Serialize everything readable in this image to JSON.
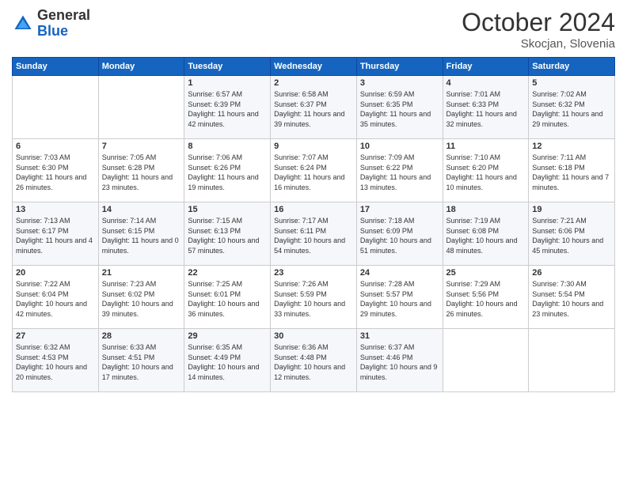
{
  "header": {
    "logo": {
      "general": "General",
      "blue": "Blue"
    },
    "month": "October 2024",
    "location": "Skocjan, Slovenia"
  },
  "weekdays": [
    "Sunday",
    "Monday",
    "Tuesday",
    "Wednesday",
    "Thursday",
    "Friday",
    "Saturday"
  ],
  "weeks": [
    [
      {
        "day": "",
        "sunrise": "",
        "sunset": "",
        "daylight": ""
      },
      {
        "day": "",
        "sunrise": "",
        "sunset": "",
        "daylight": ""
      },
      {
        "day": "1",
        "sunrise": "Sunrise: 6:57 AM",
        "sunset": "Sunset: 6:39 PM",
        "daylight": "Daylight: 11 hours and 42 minutes."
      },
      {
        "day": "2",
        "sunrise": "Sunrise: 6:58 AM",
        "sunset": "Sunset: 6:37 PM",
        "daylight": "Daylight: 11 hours and 39 minutes."
      },
      {
        "day": "3",
        "sunrise": "Sunrise: 6:59 AM",
        "sunset": "Sunset: 6:35 PM",
        "daylight": "Daylight: 11 hours and 35 minutes."
      },
      {
        "day": "4",
        "sunrise": "Sunrise: 7:01 AM",
        "sunset": "Sunset: 6:33 PM",
        "daylight": "Daylight: 11 hours and 32 minutes."
      },
      {
        "day": "5",
        "sunrise": "Sunrise: 7:02 AM",
        "sunset": "Sunset: 6:32 PM",
        "daylight": "Daylight: 11 hours and 29 minutes."
      }
    ],
    [
      {
        "day": "6",
        "sunrise": "Sunrise: 7:03 AM",
        "sunset": "Sunset: 6:30 PM",
        "daylight": "Daylight: 11 hours and 26 minutes."
      },
      {
        "day": "7",
        "sunrise": "Sunrise: 7:05 AM",
        "sunset": "Sunset: 6:28 PM",
        "daylight": "Daylight: 11 hours and 23 minutes."
      },
      {
        "day": "8",
        "sunrise": "Sunrise: 7:06 AM",
        "sunset": "Sunset: 6:26 PM",
        "daylight": "Daylight: 11 hours and 19 minutes."
      },
      {
        "day": "9",
        "sunrise": "Sunrise: 7:07 AM",
        "sunset": "Sunset: 6:24 PM",
        "daylight": "Daylight: 11 hours and 16 minutes."
      },
      {
        "day": "10",
        "sunrise": "Sunrise: 7:09 AM",
        "sunset": "Sunset: 6:22 PM",
        "daylight": "Daylight: 11 hours and 13 minutes."
      },
      {
        "day": "11",
        "sunrise": "Sunrise: 7:10 AM",
        "sunset": "Sunset: 6:20 PM",
        "daylight": "Daylight: 11 hours and 10 minutes."
      },
      {
        "day": "12",
        "sunrise": "Sunrise: 7:11 AM",
        "sunset": "Sunset: 6:18 PM",
        "daylight": "Daylight: 11 hours and 7 minutes."
      }
    ],
    [
      {
        "day": "13",
        "sunrise": "Sunrise: 7:13 AM",
        "sunset": "Sunset: 6:17 PM",
        "daylight": "Daylight: 11 hours and 4 minutes."
      },
      {
        "day": "14",
        "sunrise": "Sunrise: 7:14 AM",
        "sunset": "Sunset: 6:15 PM",
        "daylight": "Daylight: 11 hours and 0 minutes."
      },
      {
        "day": "15",
        "sunrise": "Sunrise: 7:15 AM",
        "sunset": "Sunset: 6:13 PM",
        "daylight": "Daylight: 10 hours and 57 minutes."
      },
      {
        "day": "16",
        "sunrise": "Sunrise: 7:17 AM",
        "sunset": "Sunset: 6:11 PM",
        "daylight": "Daylight: 10 hours and 54 minutes."
      },
      {
        "day": "17",
        "sunrise": "Sunrise: 7:18 AM",
        "sunset": "Sunset: 6:09 PM",
        "daylight": "Daylight: 10 hours and 51 minutes."
      },
      {
        "day": "18",
        "sunrise": "Sunrise: 7:19 AM",
        "sunset": "Sunset: 6:08 PM",
        "daylight": "Daylight: 10 hours and 48 minutes."
      },
      {
        "day": "19",
        "sunrise": "Sunrise: 7:21 AM",
        "sunset": "Sunset: 6:06 PM",
        "daylight": "Daylight: 10 hours and 45 minutes."
      }
    ],
    [
      {
        "day": "20",
        "sunrise": "Sunrise: 7:22 AM",
        "sunset": "Sunset: 6:04 PM",
        "daylight": "Daylight: 10 hours and 42 minutes."
      },
      {
        "day": "21",
        "sunrise": "Sunrise: 7:23 AM",
        "sunset": "Sunset: 6:02 PM",
        "daylight": "Daylight: 10 hours and 39 minutes."
      },
      {
        "day": "22",
        "sunrise": "Sunrise: 7:25 AM",
        "sunset": "Sunset: 6:01 PM",
        "daylight": "Daylight: 10 hours and 36 minutes."
      },
      {
        "day": "23",
        "sunrise": "Sunrise: 7:26 AM",
        "sunset": "Sunset: 5:59 PM",
        "daylight": "Daylight: 10 hours and 33 minutes."
      },
      {
        "day": "24",
        "sunrise": "Sunrise: 7:28 AM",
        "sunset": "Sunset: 5:57 PM",
        "daylight": "Daylight: 10 hours and 29 minutes."
      },
      {
        "day": "25",
        "sunrise": "Sunrise: 7:29 AM",
        "sunset": "Sunset: 5:56 PM",
        "daylight": "Daylight: 10 hours and 26 minutes."
      },
      {
        "day": "26",
        "sunrise": "Sunrise: 7:30 AM",
        "sunset": "Sunset: 5:54 PM",
        "daylight": "Daylight: 10 hours and 23 minutes."
      }
    ],
    [
      {
        "day": "27",
        "sunrise": "Sunrise: 6:32 AM",
        "sunset": "Sunset: 4:53 PM",
        "daylight": "Daylight: 10 hours and 20 minutes."
      },
      {
        "day": "28",
        "sunrise": "Sunrise: 6:33 AM",
        "sunset": "Sunset: 4:51 PM",
        "daylight": "Daylight: 10 hours and 17 minutes."
      },
      {
        "day": "29",
        "sunrise": "Sunrise: 6:35 AM",
        "sunset": "Sunset: 4:49 PM",
        "daylight": "Daylight: 10 hours and 14 minutes."
      },
      {
        "day": "30",
        "sunrise": "Sunrise: 6:36 AM",
        "sunset": "Sunset: 4:48 PM",
        "daylight": "Daylight: 10 hours and 12 minutes."
      },
      {
        "day": "31",
        "sunrise": "Sunrise: 6:37 AM",
        "sunset": "Sunset: 4:46 PM",
        "daylight": "Daylight: 10 hours and 9 minutes."
      },
      {
        "day": "",
        "sunrise": "",
        "sunset": "",
        "daylight": ""
      },
      {
        "day": "",
        "sunrise": "",
        "sunset": "",
        "daylight": ""
      }
    ]
  ]
}
